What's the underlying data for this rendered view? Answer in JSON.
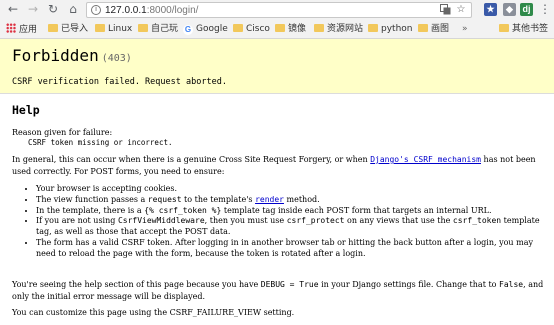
{
  "browser": {
    "url_host": "127.0.0.1",
    "url_path": ":8000/login/",
    "nav": {
      "back": "←",
      "forward": "→",
      "reload": "↻",
      "home": "⌂"
    },
    "extension_label": "dj",
    "bookmarks": [
      {
        "label": "应用",
        "icon": "apps-icon"
      },
      {
        "label": "已导入",
        "icon": "folder-icon"
      },
      {
        "label": "Linux",
        "icon": "folder-icon"
      },
      {
        "label": "自己玩",
        "icon": "folder-icon"
      },
      {
        "label": "Google",
        "icon": "google-icon"
      },
      {
        "label": "Cisco",
        "icon": "folder-icon"
      },
      {
        "label": "镜像",
        "icon": "folder-icon"
      },
      {
        "label": "资源网站",
        "icon": "folder-icon"
      },
      {
        "label": "python",
        "icon": "folder-icon"
      },
      {
        "label": "画图",
        "icon": "folder-icon"
      }
    ],
    "other_bookmarks": "其他书签",
    "more_bookmarks": "»"
  },
  "summary": {
    "title": "Forbidden",
    "code": "(403)",
    "message": "CSRF verification failed. Request aborted."
  },
  "info": {
    "heading": "Help",
    "reason_label": "Reason given for failure:",
    "reason": "CSRF token missing or incorrect.",
    "intro_before_link": "In general, this can occur when there is a genuine Cross Site Request Forgery, or when ",
    "intro_link": "Django's CSRF mechanism",
    "intro_after_link": " has not been used correctly. For POST forms, you need to ensure:",
    "item1": "Your browser is accepting cookies.",
    "item2_before": "The view function passes a ",
    "item2_code1": "request",
    "item2_mid": " to the template's ",
    "item2_link": "render",
    "item2_after": " method.",
    "item3_before": "In the template, there is a ",
    "item3_code": "{% csrf_token %}",
    "item3_after": " template tag inside each POST form that targets an internal URL.",
    "item4_before": "If you are not using ",
    "item4_code1": "CsrfViewMiddleware",
    "item4_mid": ", then you must use ",
    "item4_code2": "csrf_protect",
    "item4_mid2": " on any views that use the ",
    "item4_code3": "csrf_token",
    "item4_after": " template tag, as well as those that accept the POST data.",
    "item5": "The form has a valid CSRF token. After logging in in another browser tab or hitting the back button after a login, you may need to reload the page with the form, because the token is rotated after a login.",
    "debug_before": "You're seeing the help section of this page because you have ",
    "debug_code": "DEBUG = True",
    "debug_after": " in your Django settings file. Change that to ",
    "debug_code2": "False",
    "debug_end": ", and only the initial error message will be displayed.",
    "custom_before": "You can customize this page using the CSRF_FAILURE_VIEW setting."
  }
}
